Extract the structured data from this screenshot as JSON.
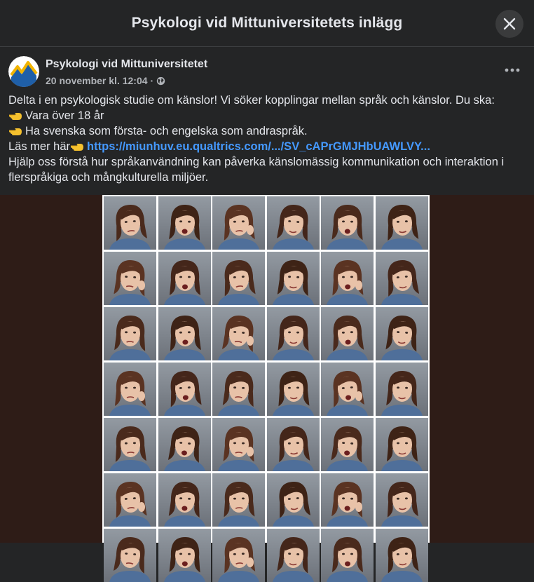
{
  "modal": {
    "title": "Psykologi vid Mittuniversitetets inlägg"
  },
  "post": {
    "author": "Psykologi vid Mittuniversitetet",
    "timestamp": "20 november kl. 12:04",
    "separator": "·",
    "text": {
      "line1": "Delta i en psykologisk studie om känslor! Vi söker kopplingar mellan språk och känslor. Du ska:",
      "line2": "Vara över 18 år",
      "line3": "Ha svenska som första- och engelska som andraspråk.",
      "line4_prefix": "Läs mer här",
      "link": "https://miunhuv.eu.qualtrics.com/.../SV_cAPrGMJHbUAWLVY...",
      "line5": "Hjälp oss förstå hur språkanvändning kan påverka känslomässig kommunikation och interaktion i flerspråkiga och mångkulturella miljöer."
    }
  },
  "media": {
    "description_icon": "emotion-face-grid",
    "rows": 7,
    "cols": 6
  },
  "colors": {
    "background": "#242526",
    "text": "#e4e6eb",
    "secondary_text": "#b0b3b8",
    "link": "#4599ff",
    "media_background": "#2e1c17"
  },
  "icons": {
    "close": "close-icon",
    "globe": "globe-icon",
    "more": "more-options-icon",
    "pointing_hand": "pointing-hand-icon"
  }
}
